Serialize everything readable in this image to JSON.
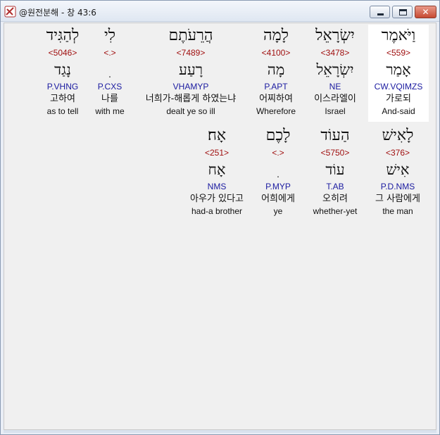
{
  "window": {
    "title": "@원전분해 - 창 43:6",
    "close_glyph": "✕"
  },
  "rows": [
    {
      "words": [
        {
          "hebrew": "וַיֹּאמֶר",
          "strong": "<559>",
          "lemma": "אָמַר",
          "morph": "CW.VQIMZS",
          "korean": "가로되",
          "english": "And-said",
          "selected": true
        },
        {
          "hebrew": "יִשְׂרָאֵל",
          "strong": "<3478>",
          "lemma": "יִשְׂרָאֵל",
          "morph": "NE",
          "korean": "이스라엘이",
          "english": "Israel"
        },
        {
          "hebrew": "לָמָה",
          "strong": "<4100>",
          "lemma": "מָה",
          "morph": "P.APT",
          "korean": "어찌하여",
          "english": "Wherefore"
        },
        {
          "hebrew": "הֲרֵעֹתֶם",
          "strong": "<7489>",
          "lemma": "רָעַע",
          "morph": "VHAMYP",
          "korean": "너희가-해롭게 하였는냐",
          "english": "dealt ye so ill"
        },
        {
          "hebrew": "לִי",
          "strong": "<.>",
          "lemma": "ׅ",
          "morph": "P.CXS",
          "korean": "나를",
          "english": "with me"
        },
        {
          "hebrew": "לְהַגִּיד",
          "strong": "<5046>",
          "lemma": "נָגַד",
          "morph": "P.VHNG",
          "korean": "고하여",
          "english": "as to tell"
        }
      ]
    },
    {
      "words": [
        {
          "hebrew": "לָאִישׁ",
          "strong": "<376>",
          "lemma": "אִישׁ",
          "morph": "P.D.NMS",
          "korean": "그 사람에게",
          "english": "the man"
        },
        {
          "hebrew": "הַעוֹד",
          "strong": "<5750>",
          "lemma": "עוֹד",
          "morph": "T.AB",
          "korean": "오히려",
          "english": "whether-yet"
        },
        {
          "hebrew": "לָכֶם",
          "strong": "<.>",
          "lemma": "ׅ",
          "morph": "P.MYP",
          "korean": "어희에게",
          "english": "ye"
        },
        {
          "hebrew": "אָח׃",
          "strong": "<251>",
          "lemma": "אָח",
          "morph": "NMS",
          "korean": "아우가 있다고",
          "english": "had-a brother"
        }
      ]
    }
  ]
}
